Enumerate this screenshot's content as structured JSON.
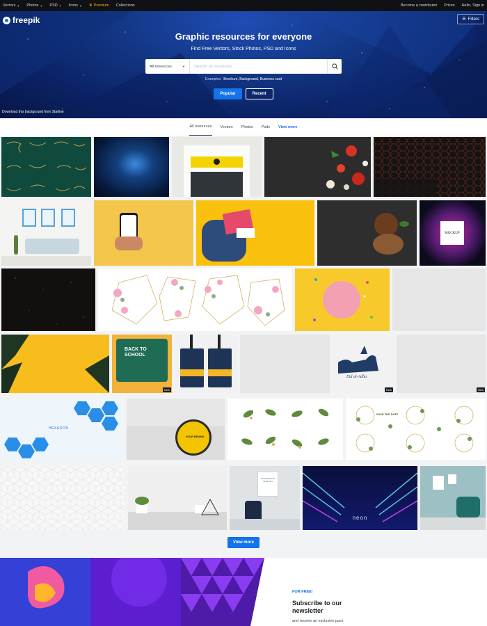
{
  "topbar": {
    "nav": [
      {
        "label": "Vectors",
        "caret": true
      },
      {
        "label": "Photos",
        "caret": true
      },
      {
        "label": "PSD",
        "caret": true
      },
      {
        "label": "Icons",
        "caret": true
      },
      {
        "label": "Premium",
        "caret": false
      },
      {
        "label": "Collections",
        "caret": false
      }
    ],
    "contributor": "Become a contributor",
    "pricing": "Prices",
    "signin": "Hello, Sign in"
  },
  "hero": {
    "logo": "freepik",
    "filters": "Filters",
    "title": "Graphic resources for everyone",
    "subtitle": "Find Free Vectors, Stock Photos, PSD and Icons",
    "search_type": "All resources",
    "search_placeholder": "Search all resources",
    "examples_label": "Examples:",
    "examples": "Brochure, Background, Business card",
    "popular": "Popular",
    "recent": "Recent",
    "credit": "Download this background from Starline"
  },
  "tabs": [
    {
      "label": "All resources",
      "active": true
    },
    {
      "label": "Vectors",
      "active": false
    },
    {
      "label": "Photos",
      "active": false
    },
    {
      "label": "Psds",
      "active": false
    },
    {
      "label": "View more",
      "active": false
    }
  ],
  "tiles": [
    {
      "name": "tile-ornament-corners",
      "text": ""
    },
    {
      "name": "tile-blue-nebula",
      "text": ""
    },
    {
      "name": "tile-storefront-mockup",
      "text": ""
    },
    {
      "name": "tile-tomatoes-flatlay",
      "text": ""
    },
    {
      "name": "tile-hexagon-dark",
      "text": ""
    },
    {
      "name": "tile-living-room-frames",
      "text": ""
    },
    {
      "name": "tile-hand-phone-yellow",
      "text": ""
    },
    {
      "name": "tile-backpack-supplies",
      "text": ""
    },
    {
      "name": "tile-coffee-beans",
      "text": ""
    },
    {
      "name": "tile-mockup-splash",
      "text": "MOCKUP"
    },
    {
      "name": "tile-starry-night",
      "text": ""
    },
    {
      "name": "tile-floral-geometric-frames",
      "text": ""
    },
    {
      "name": "tile-pink-circle-confetti",
      "text": ""
    },
    {
      "name": "tile-blank-grey-1",
      "text": ""
    },
    {
      "name": "tile-palm-leaves-yellow",
      "text": ""
    },
    {
      "name": "tile-back-to-school",
      "text": "BACK TO SCHOOL"
    },
    {
      "name": "tile-id-card-lanyard",
      "text": ""
    },
    {
      "name": "tile-blank-grey-2",
      "text": ""
    },
    {
      "name": "tile-eid-goat",
      "text": "Eid al-Adha"
    },
    {
      "name": "tile-blank-grey-3",
      "text": ""
    },
    {
      "name": "tile-hexagon-blue",
      "text": "HEXAGON"
    },
    {
      "name": "tile-sign-mockup",
      "text": "YOUR BRAND"
    },
    {
      "name": "tile-leaves-watercolor",
      "text": ""
    },
    {
      "name": "tile-wedding-wreaths",
      "text": "SAVE THE DATE"
    },
    {
      "name": "tile-cube-pattern",
      "text": ""
    },
    {
      "name": "tile-white-room-plants",
      "text": ""
    },
    {
      "name": "tile-chair-poster",
      "text": "NEVER STOP SMILING"
    },
    {
      "name": "tile-neon-tunnel",
      "text": "neon"
    },
    {
      "name": "tile-armchair-frames",
      "text": ""
    }
  ],
  "badge": "New",
  "view_more": "View more",
  "newsletter": {
    "free": "FOR FREE!",
    "title": "Subscribe to our newsletter",
    "desc": "and receive an exclusive pack"
  },
  "colors": {
    "accent": "#1273eb",
    "topbar": "#0f1114",
    "hero_dark": "#0b2265",
    "premium": "#f7b500"
  }
}
